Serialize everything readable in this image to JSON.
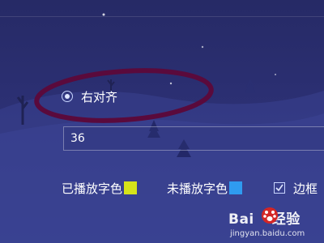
{
  "alignment_option": {
    "label": "右对齐",
    "selected": true
  },
  "font_size_input": {
    "value": "36"
  },
  "played_color": {
    "label": "已播放字色",
    "color": "#d6e31a"
  },
  "unplayed_color": {
    "label": "未播放字色",
    "color": "#2f9bf0"
  },
  "border_option": {
    "label": "边框",
    "checked": true
  },
  "annotation": {
    "color": "#5a0a3c"
  },
  "watermark": {
    "brand_left": "Bai",
    "brand_right": "经验",
    "url": "jingyan.baidu.com"
  }
}
